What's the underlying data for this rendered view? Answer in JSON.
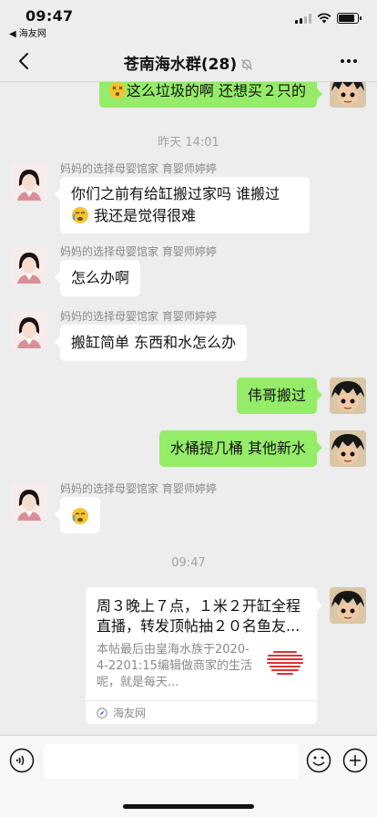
{
  "status_bar": {
    "time": "09:47",
    "back_app": "◀ 海友网"
  },
  "header": {
    "title": "苍南海水群(28)"
  },
  "messages": {
    "m0": {
      "text": "这么垃圾的啊 还想买２只的"
    },
    "ts1": "昨天 14:01",
    "m1": {
      "sender": "妈妈的选择母婴馆家 育婴师婷婷",
      "line1": "你们之前有给缸搬过家吗 谁搬过",
      "line2": "我还是觉得很难"
    },
    "m2": {
      "sender": "妈妈的选择母婴馆家 育婴师婷婷",
      "text": "怎么办啊"
    },
    "m3": {
      "sender": "妈妈的选择母婴馆家 育婴师婷婷",
      "text": "搬缸简单 东西和水怎么办"
    },
    "m4": {
      "text": "伟哥搬过"
    },
    "m5": {
      "text": "水桶提几桶 其他新水"
    },
    "m6": {
      "sender": "妈妈的选择母婴馆家 育婴师婷婷"
    },
    "ts2": "09:47",
    "card": {
      "title": "周３晚上７点，１米２开缸全程直播，转发顶帖抽２０名鱼友...",
      "desc": "本帖最后由皇海水族于2020-4-2201:15编辑做商家的生活呢，就是每天...",
      "source": "海友网"
    }
  },
  "colors": {
    "out_bubble": "#95ec69",
    "in_bubble": "#ffffff",
    "background": "#ededed"
  }
}
